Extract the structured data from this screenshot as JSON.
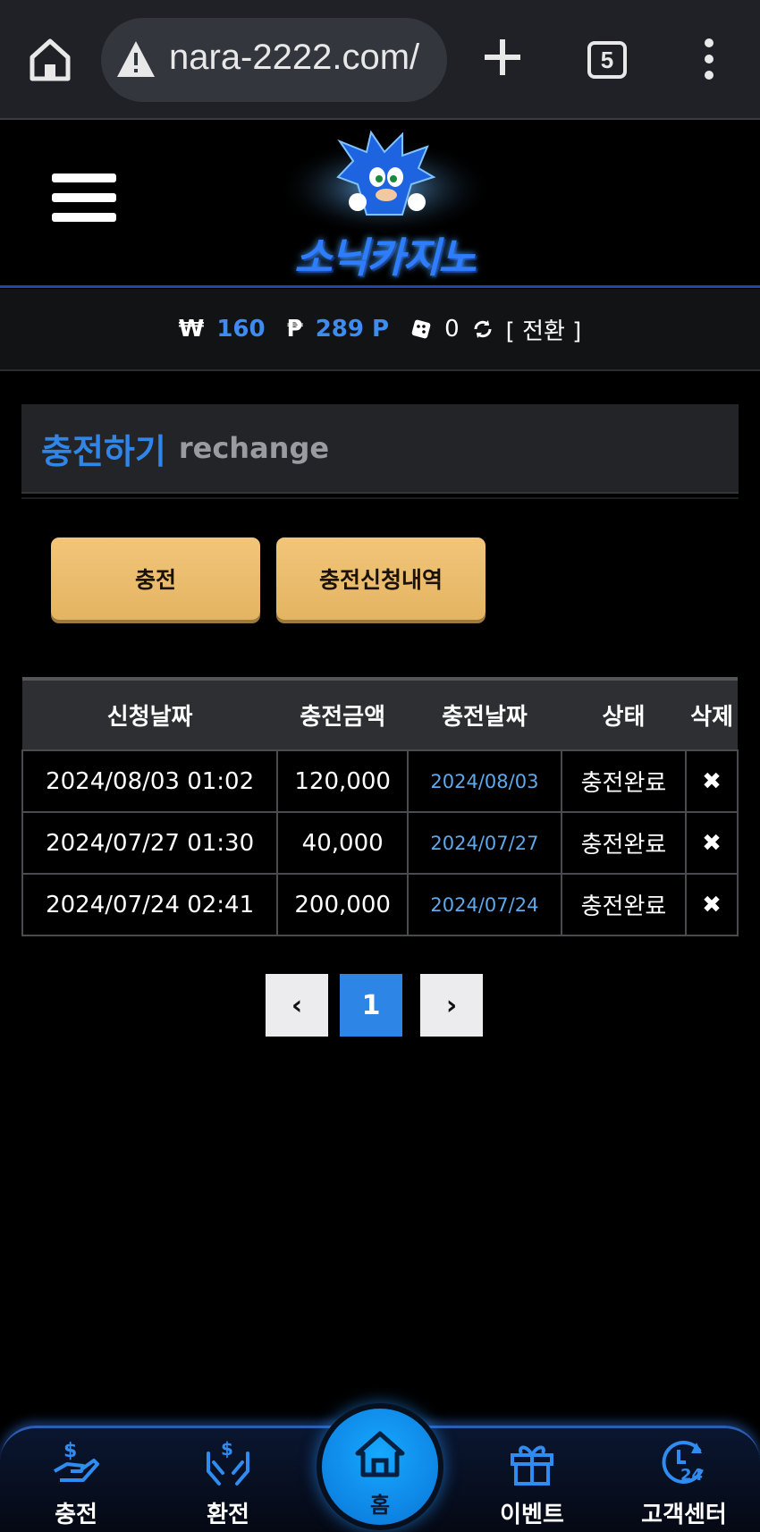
{
  "browser": {
    "url": "nara-2222.com/",
    "tab_count": "5"
  },
  "site": {
    "logo_text": "소닉카지노"
  },
  "balance": {
    "won_symbol": "₩",
    "won_value": "160",
    "point_symbol": "₱",
    "point_value": "289 P",
    "dice_value": "0",
    "convert_label": "[ 전환 ]"
  },
  "page": {
    "title_ko": "충전하기",
    "title_en": "rechange"
  },
  "buttons": {
    "charge": "충전",
    "history": "충전신청내역"
  },
  "table": {
    "headers": [
      "신청날짜",
      "충전금액",
      "충전날짜",
      "상태",
      "삭제"
    ],
    "rows": [
      {
        "request_date": "2024/08/03 01:02",
        "amount": "120,000",
        "charge_date": "2024/08/03",
        "status": "충전완료",
        "delete": "✖"
      },
      {
        "request_date": "2024/07/27 01:30",
        "amount": "40,000",
        "charge_date": "2024/07/27",
        "status": "충전완료",
        "delete": "✖"
      },
      {
        "request_date": "2024/07/24 02:41",
        "amount": "200,000",
        "charge_date": "2024/07/24",
        "status": "충전완료",
        "delete": "✖"
      }
    ]
  },
  "pagination": {
    "prev": "‹",
    "current": "1",
    "next": "›"
  },
  "bottom_nav": {
    "charge": "충전",
    "exchange": "환전",
    "home": "홈",
    "event": "이벤트",
    "support": "고객센터"
  },
  "colors": {
    "accent_blue": "#2f86e8",
    "gold": "#e3b461",
    "link_blue": "#5fa8ea"
  }
}
